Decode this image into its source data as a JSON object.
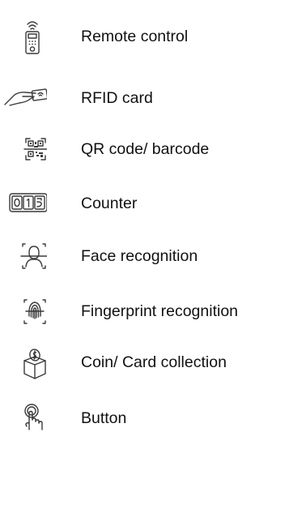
{
  "items": [
    {
      "icon": "remote-control-icon",
      "label": "Remote control"
    },
    {
      "icon": "rfid-card-icon",
      "label": "RFID card"
    },
    {
      "icon": "qr-code-icon",
      "label": "QR code/ barcode"
    },
    {
      "icon": "counter-icon",
      "label": "Counter"
    },
    {
      "icon": "face-recognition-icon",
      "label": "Face recognition"
    },
    {
      "icon": "fingerprint-icon",
      "label": "Fingerprint recognition"
    },
    {
      "icon": "coin-card-collection-icon",
      "label": "Coin/ Card collection"
    },
    {
      "icon": "button-press-icon",
      "label": "Button"
    }
  ],
  "colors": {
    "text": "#111111",
    "icon_stroke": "#3a3a3a",
    "background": "#ffffff"
  }
}
